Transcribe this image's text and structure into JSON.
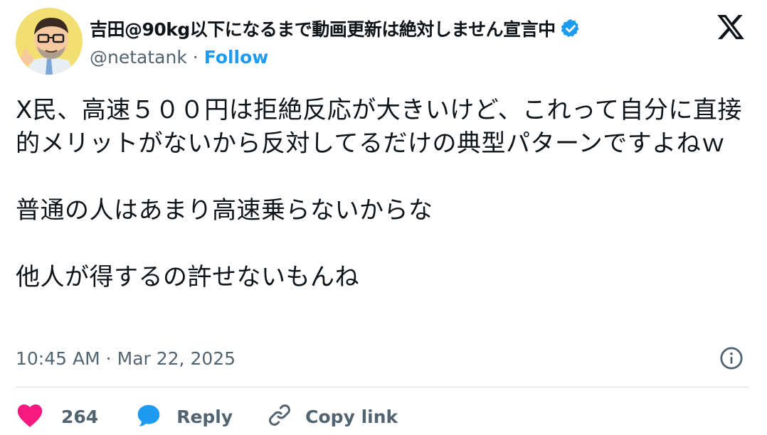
{
  "author": {
    "display_name": "吉田@90kg以下になるまで動画更新は絶対しません宣言中",
    "handle": "@netatank",
    "separator": "·",
    "follow_label": "Follow"
  },
  "tweet": {
    "text": "X民、高速５００円は拒絶反応が大きいけど、これって自分に直接的メリットがないから反対してるだけの典型パターンですよねｗ\n\n普通の人はあまり高速乗らないからな\n\n他人が得するの許せないもんね",
    "time": "10:45 AM",
    "separator": "·",
    "date": "Mar 22, 2025"
  },
  "actions": {
    "like_count": "264",
    "reply_label": "Reply",
    "copy_label": "Copy link"
  },
  "colors": {
    "brand_blue": "#1d9bf0",
    "like_pink": "#f91880",
    "muted": "#536471",
    "text": "#0f1419"
  },
  "icons": {
    "verified": "verified-badge-icon",
    "x_logo": "x-logo-icon",
    "info": "info-icon",
    "like": "heart-icon",
    "reply": "reply-bubble-icon",
    "copy": "link-icon"
  }
}
